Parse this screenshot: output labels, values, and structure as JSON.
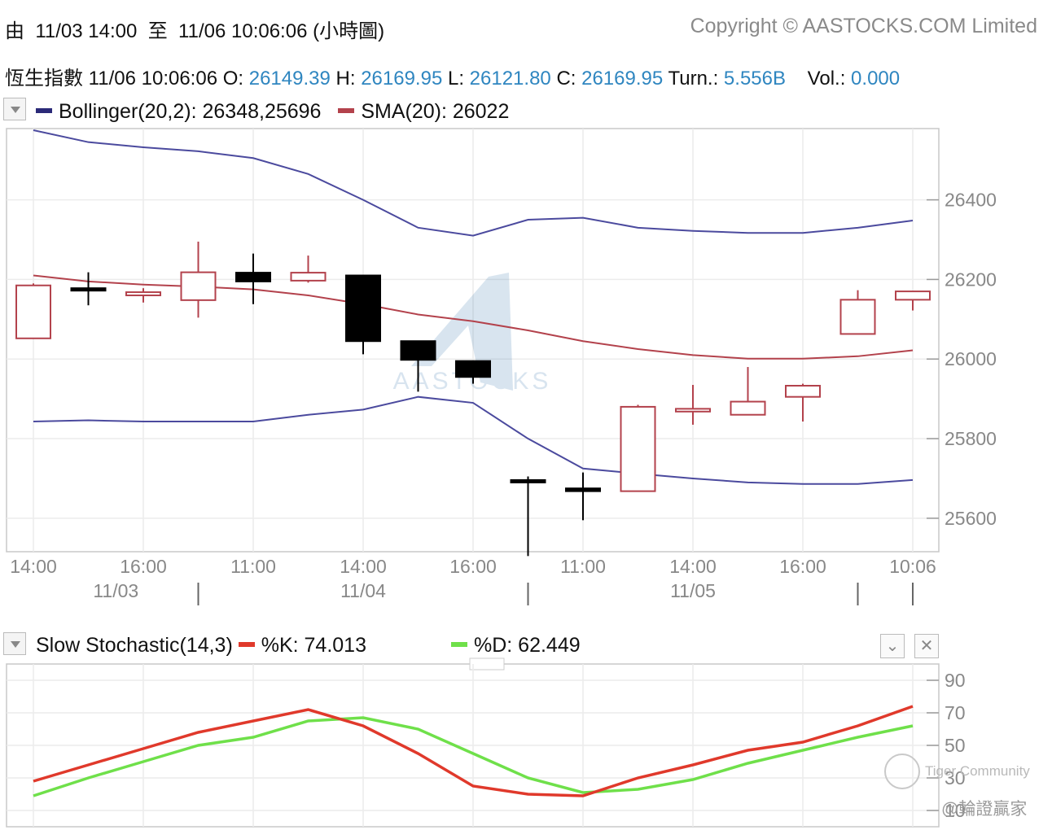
{
  "header": {
    "range_prefix": "由",
    "range_start": "11/03 14:00",
    "range_mid": "至",
    "range_end": "11/06 10:06:06",
    "range_suffix": "(小時圖)",
    "copyright": "Copyright © AASTOCKS.COM Limited"
  },
  "quote": {
    "index_name": "恆生指數",
    "time": "11/06 10:06:06",
    "o_label": "O:",
    "o_value": "26149.39",
    "h_label": "H:",
    "h_value": "26169.95",
    "l_label": "L:",
    "l_value": "26121.80",
    "c_label": "C:",
    "c_value": "26169.95",
    "turn_label": "Turn.:",
    "turn_value": "5.556B",
    "vol_label": "Vol.:",
    "vol_value": "0.000"
  },
  "legend_main": {
    "bollinger": "Bollinger(20,2): 26348,25696",
    "sma": "SMA(20): 26022"
  },
  "legend_stoch": {
    "title": "Slow Stochastic(14,3)",
    "k": "%K: 74.013",
    "d": "%D: 62.449"
  },
  "watermark": {
    "text": "AASTOCKS"
  },
  "overlay": {
    "community": "Tiger Community",
    "handle": "@輪證贏家"
  },
  "colors": {
    "bollinger": "#4b4a9e",
    "sma": "#b3424c",
    "up_candle": "#b3424c",
    "down_candle": "#000000",
    "k_line": "#e0392b",
    "d_line": "#6fe04a",
    "price_text": "#2f86c0"
  },
  "chart_data": [
    {
      "type": "candlestick",
      "title": "恆生指數",
      "x_ticks": [
        "14:00",
        "16:00",
        "11:00",
        "14:00",
        "16:00",
        "11:00",
        "14:00",
        "16:00",
        "10:06"
      ],
      "x_tick_index": [
        0,
        2,
        4,
        6,
        8,
        10,
        12,
        14,
        16
      ],
      "date_labels": [
        "11/03",
        "11/04",
        "11/05"
      ],
      "date_label_index": [
        1.5,
        6,
        12
      ],
      "date_separator_index": [
        3,
        9,
        15,
        16
      ],
      "y_ticks": [
        26400,
        26200,
        26000,
        25800,
        25600
      ],
      "ylim": [
        25520,
        26575
      ],
      "candles": [
        {
          "o": 26052,
          "h": 26190,
          "l": 26052,
          "c": 26185
        },
        {
          "o": 26178,
          "h": 26218,
          "l": 26135,
          "c": 26176
        },
        {
          "o": 26160,
          "h": 26178,
          "l": 26142,
          "c": 26168
        },
        {
          "o": 26148,
          "h": 26295,
          "l": 26104,
          "c": 26218
        },
        {
          "o": 26217,
          "h": 26265,
          "l": 26138,
          "c": 26195
        },
        {
          "o": 26197,
          "h": 26260,
          "l": 26192,
          "c": 26217
        },
        {
          "o": 26210,
          "h": 26210,
          "l": 26012,
          "c": 26045
        },
        {
          "o": 26045,
          "h": 26045,
          "l": 25918,
          "c": 25998
        },
        {
          "o": 25995,
          "h": 25995,
          "l": 25938,
          "c": 25955
        },
        {
          "o": 25696,
          "h": 25705,
          "l": 25505,
          "c": 25690
        },
        {
          "o": 25675,
          "h": 25715,
          "l": 25595,
          "c": 25668
        },
        {
          "o": 25668,
          "h": 25885,
          "l": 25668,
          "c": 25880
        },
        {
          "o": 25868,
          "h": 25935,
          "l": 25835,
          "c": 25875
        },
        {
          "o": 25860,
          "h": 25980,
          "l": 25860,
          "c": 25893
        },
        {
          "o": 25905,
          "h": 25938,
          "l": 25843,
          "c": 25933
        },
        {
          "o": 26063,
          "h": 26173,
          "l": 26063,
          "c": 26149
        },
        {
          "o": 26149,
          "h": 26170,
          "l": 26122,
          "c": 26170
        }
      ],
      "series": [
        {
          "name": "Bollinger(20,2)",
          "values": [
            26575,
            26545,
            26532,
            26522,
            26505,
            26465,
            26400,
            26330,
            26310,
            26350,
            26355,
            26330,
            26322,
            26317,
            26317,
            26330,
            26348
          ]
        },
        {
          "name": "Bollinger(20,2)",
          "values": [
            25843,
            25846,
            25843,
            25843,
            25843,
            25860,
            25873,
            25905,
            25890,
            25800,
            25725,
            25712,
            25700,
            25690,
            25686,
            25686,
            25696
          ]
        },
        {
          "name": "SMA(20)",
          "values": [
            26210,
            26195,
            26187,
            26182,
            26175,
            26160,
            26138,
            26112,
            26095,
            26072,
            26045,
            26025,
            26010,
            26001,
            26001,
            26007,
            26022
          ]
        }
      ]
    },
    {
      "type": "line",
      "title": "Slow Stochastic(14,3)",
      "y_ticks": [
        90,
        70,
        50,
        30,
        10
      ],
      "ylim": [
        0,
        100
      ],
      "series": [
        {
          "name": "%K",
          "values": [
            28,
            38,
            48,
            58,
            65,
            72,
            62,
            45,
            25,
            20,
            19,
            30,
            38,
            47,
            52,
            62,
            74
          ]
        },
        {
          "name": "%D",
          "values": [
            19,
            30,
            40,
            50,
            55,
            65,
            67,
            60,
            45,
            30,
            21,
            23,
            29,
            39,
            47,
            55,
            62
          ]
        }
      ]
    }
  ]
}
